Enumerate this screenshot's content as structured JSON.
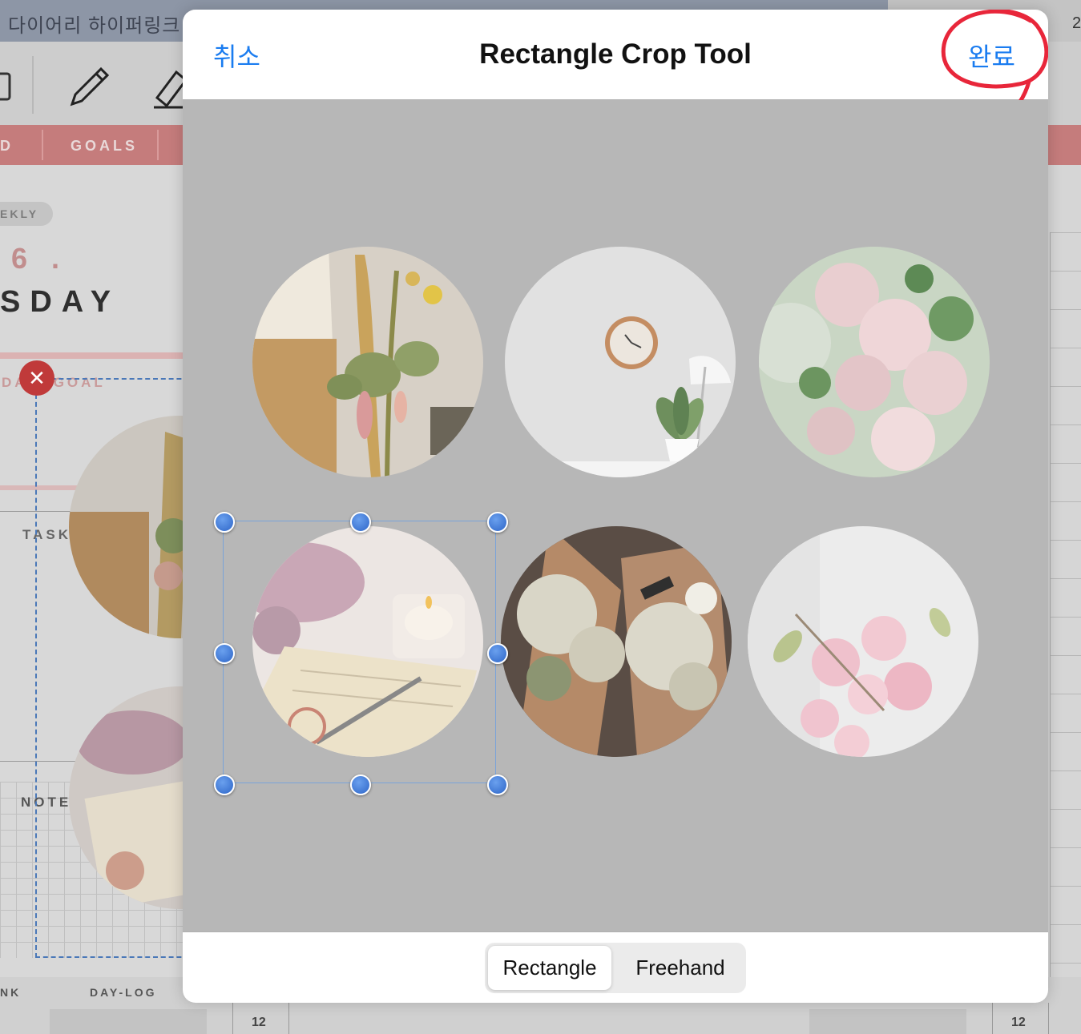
{
  "background_app": {
    "title": "다이어리 하이퍼링크",
    "page_number_top": "2",
    "nav": {
      "partial_left": "D",
      "goals": "GOALS"
    },
    "weekly_label": "EKLY",
    "date_number": "6 .",
    "day_name": "SDAY",
    "goal_label": "DA  S GOAL",
    "task_label": "TASK",
    "note_label": "NOTE",
    "footer": {
      "partial_left": "NK",
      "day_log": "DAY-LOG",
      "page_left": "12",
      "page_right": "12"
    }
  },
  "modal": {
    "cancel_label": "취소",
    "title": "Rectangle Crop Tool",
    "done_label": "완료",
    "photos": [
      {
        "name": "dried-flower-bouquet"
      },
      {
        "name": "wall-clock-plant"
      },
      {
        "name": "pink-blossom-branches"
      },
      {
        "name": "planner-candle-flowers"
      },
      {
        "name": "white-flower-bouquets"
      },
      {
        "name": "pink-cherry-blossoms"
      }
    ],
    "modes": {
      "rectangle": "Rectangle",
      "freehand": "Freehand",
      "active": "rectangle"
    }
  },
  "colors": {
    "accent": "#1a7cf0",
    "annotation": "#e8263a",
    "handle": "#3a74d6"
  }
}
